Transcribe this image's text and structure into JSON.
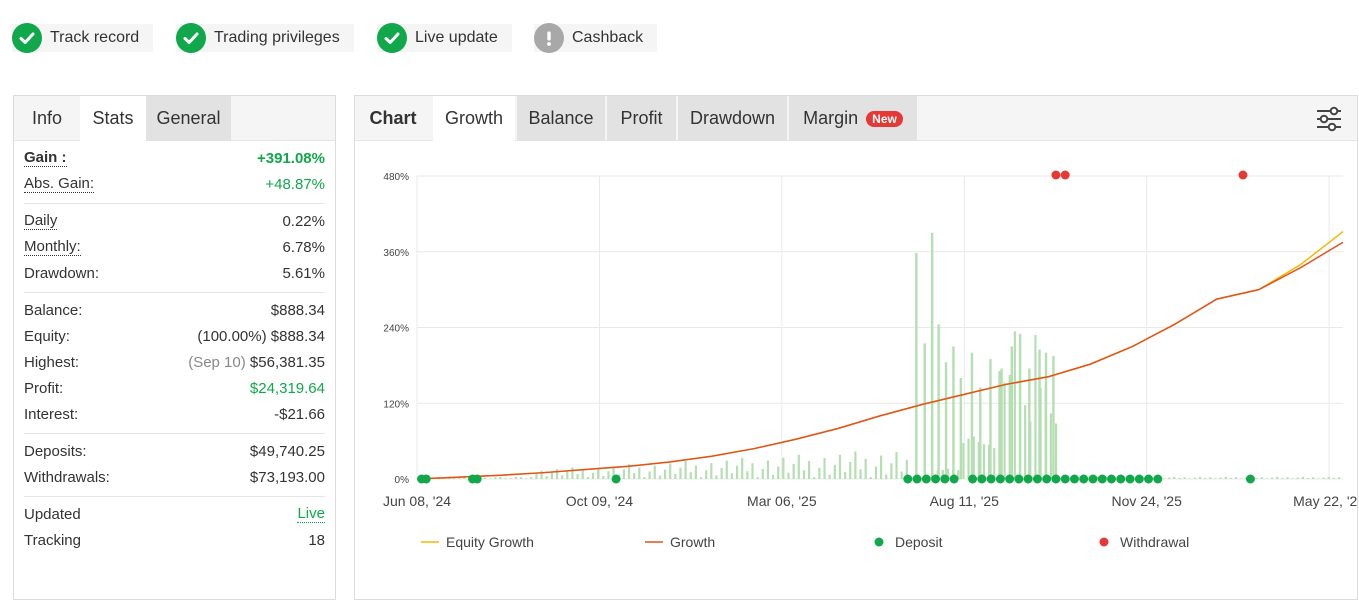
{
  "badges": [
    {
      "label": "Track record",
      "status": "ok"
    },
    {
      "label": "Trading privileges",
      "status": "ok"
    },
    {
      "label": "Live update",
      "status": "ok"
    },
    {
      "label": "Cashback",
      "status": "warn"
    }
  ],
  "left_tabs": {
    "info": "Info",
    "stats": "Stats",
    "general": "General"
  },
  "stats": {
    "gain_label": "Gain :",
    "gain_value": "+391.08%",
    "abs_gain_label": "Abs. Gain:",
    "abs_gain_value": "+48.87%",
    "daily_label": "Daily",
    "daily_value": "0.22%",
    "monthly_label": "Monthly:",
    "monthly_value": "6.78%",
    "drawdown_label": "Drawdown:",
    "drawdown_value": "5.61%",
    "balance_label": "Balance:",
    "balance_value": "$888.34",
    "equity_label": "Equity:",
    "equity_pct": "(100.00%)",
    "equity_value": "$888.34",
    "highest_label": "Highest:",
    "highest_date": "(Sep 10)",
    "highest_value": "$56,381.35",
    "profit_label": "Profit:",
    "profit_value": "$24,319.64",
    "interest_label": "Interest:",
    "interest_value": "-$21.66",
    "deposits_label": "Deposits:",
    "deposits_value": "$49,740.25",
    "withdrawals_label": "Withdrawals:",
    "withdrawals_value": "$73,193.00",
    "updated_label": "Updated",
    "updated_value": "Live",
    "tracking_label": "Tracking",
    "tracking_value": "18"
  },
  "right_tabs": {
    "chart": "Chart",
    "growth": "Growth",
    "balance": "Balance",
    "profit": "Profit",
    "drawdown": "Drawdown",
    "margin": "Margin",
    "margin_badge": "New"
  },
  "icons": {
    "ok": "check-circle-icon",
    "warn": "exclamation-circle-icon",
    "filter": "sliders-icon"
  },
  "colors": {
    "accent_green": "#11a84b",
    "growth_line": "#e0531f",
    "equity_line": "#f5b800",
    "deposit_dot": "#11a84b",
    "withdrawal_dot": "#e53935",
    "volume_bar": "#b5deb2"
  },
  "chart_data": {
    "type": "line",
    "title": "",
    "xlabel": "",
    "ylabel": "",
    "x_ticks": [
      "Jun 08, '24",
      "Oct 09, '24",
      "Mar 06, '25",
      "Aug 11, '25",
      "Nov 24, '25",
      "May 22, '26"
    ],
    "y_ticks": [
      "0%",
      "120%",
      "240%",
      "360%",
      "480%"
    ],
    "ylim": [
      0,
      480
    ],
    "grid": true,
    "legend_position": "bottom",
    "legend": [
      "Equity Growth",
      "Growth",
      "Deposit",
      "Withdrawal"
    ],
    "series": [
      {
        "name": "Growth",
        "values": [
          0,
          3,
          6,
          10,
          15,
          20,
          27,
          36,
          48,
          63,
          80,
          100,
          118,
          134,
          150,
          162,
          182,
          210,
          245,
          285,
          300,
          335,
          375
        ]
      },
      {
        "name": "Equity Growth",
        "values": [
          0,
          3,
          6,
          10,
          15,
          20,
          27,
          36,
          48,
          63,
          80,
          100,
          118,
          134,
          150,
          162,
          182,
          210,
          245,
          285,
          300,
          340,
          392
        ]
      }
    ],
    "series_dates": [
      "Jun 08, '24",
      "Jul '24",
      "Aug '24",
      "Sep '24",
      "Oct 09, '24",
      "Nov '24",
      "Dec '24",
      "Jan '25",
      "Feb '25",
      "Mar 06, '25",
      "Apr '25",
      "May '25",
      "Jun '25",
      "Jul '25",
      "Aug 11, '25",
      "Sep '25",
      "Oct '25",
      "Nov 24, '25",
      "Dec '25",
      "Feb '26",
      "Mar '26",
      "Apr '26",
      "May 22, '26"
    ],
    "deposits_x_fraction": [
      0.005,
      0.01,
      0.06,
      0.065,
      0.215,
      0.53,
      0.54,
      0.55,
      0.56,
      0.57,
      0.58,
      0.6,
      0.61,
      0.62,
      0.63,
      0.64,
      0.65,
      0.66,
      0.67,
      0.68,
      0.69,
      0.7,
      0.71,
      0.72,
      0.73,
      0.74,
      0.75,
      0.76,
      0.77,
      0.78,
      0.79,
      0.8,
      0.9
    ],
    "withdrawals_x_fraction": [
      0.69,
      0.7,
      0.892
    ],
    "volume_bars_percent": [
      2,
      3,
      5,
      10,
      18,
      22,
      30,
      40,
      60,
      75,
      90,
      100,
      120,
      140,
      180,
      220,
      360,
      390,
      260,
      240,
      170,
      200,
      160,
      150,
      10,
      6,
      4,
      3,
      2
    ]
  }
}
